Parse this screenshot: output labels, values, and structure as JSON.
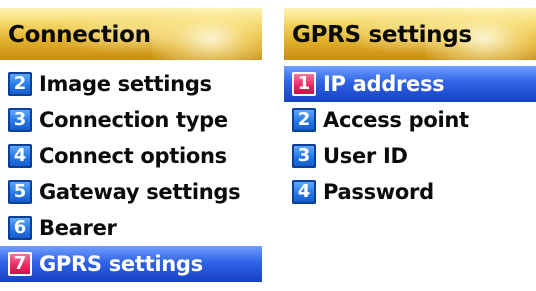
{
  "left_screen": {
    "title": "Connection",
    "items": [
      {
        "num": "2",
        "label": "Image settings"
      },
      {
        "num": "3",
        "label": "Connection type"
      },
      {
        "num": "4",
        "label": "Connect options"
      },
      {
        "num": "5",
        "label": "Gateway settings"
      },
      {
        "num": "6",
        "label": "Bearer"
      },
      {
        "num": "7",
        "label": "GPRS settings"
      }
    ],
    "selected_item": "GPRS settings"
  },
  "right_screen": {
    "title": "GPRS settings",
    "items": [
      {
        "num": "1",
        "label": "IP address"
      },
      {
        "num": "2",
        "label": "Access point"
      },
      {
        "num": "3",
        "label": "User ID"
      },
      {
        "num": "4",
        "label": "Password"
      }
    ],
    "selected_item": "IP address"
  },
  "colors": {
    "title_bar_gold": "#e2b12c",
    "highlight_blue": "#2f63e6",
    "badge_blue": "#2478e8",
    "badge_selected_pink": "#e8245f"
  }
}
